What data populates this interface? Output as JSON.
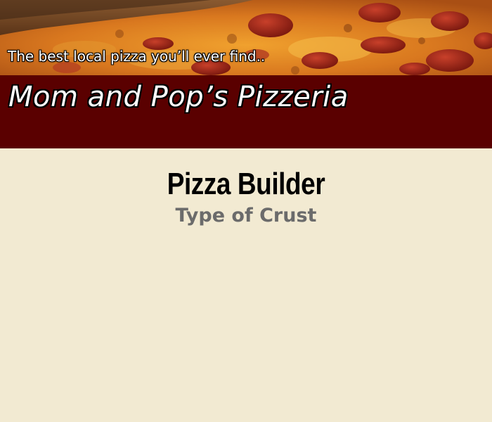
{
  "header": {
    "tagline": "The best local pizza you’ll ever find..",
    "brand_name": "Mom and Pop’s Pizzeria",
    "band_color": "#5a0000",
    "hero_image": "pepperoni-pizza-photo"
  },
  "main": {
    "title": "Pizza Builder",
    "section_heading": "Type of Crust",
    "background_color": "#f2ead2"
  }
}
